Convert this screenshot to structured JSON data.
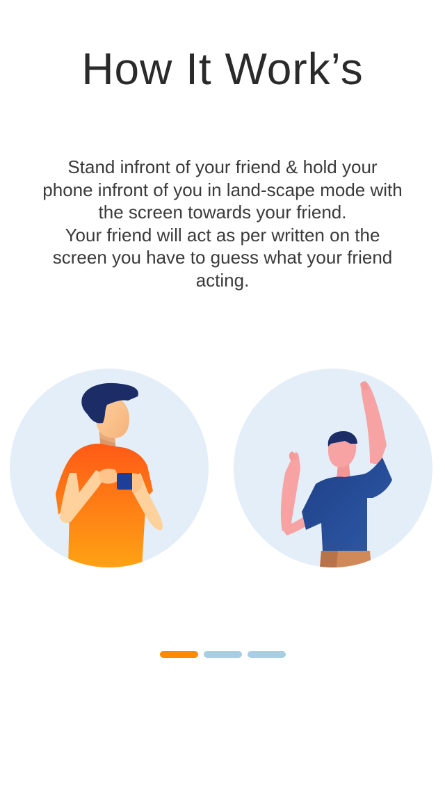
{
  "page": {
    "title": "How It Work’s",
    "instructions": [
      "Stand infront of your friend & hold your phone infront of you in land-scape mode with the screen towards your friend.",
      "Your friend will act as per written on the screen you have to guess what your friend acting."
    ]
  },
  "illustrations": [
    {
      "icon": "person-holding-phone-icon"
    },
    {
      "icon": "person-waving-icon"
    }
  ],
  "pager": {
    "dots": 3,
    "active_index": 0,
    "active_color": "#ff8a00",
    "inactive_color": "#a9cde3"
  },
  "colors": {
    "circle_bg": "#e3eef8",
    "orange_shirt": "#ff6a14",
    "blue_shirt": "#1f3f86",
    "hair": "#1c2c66"
  }
}
